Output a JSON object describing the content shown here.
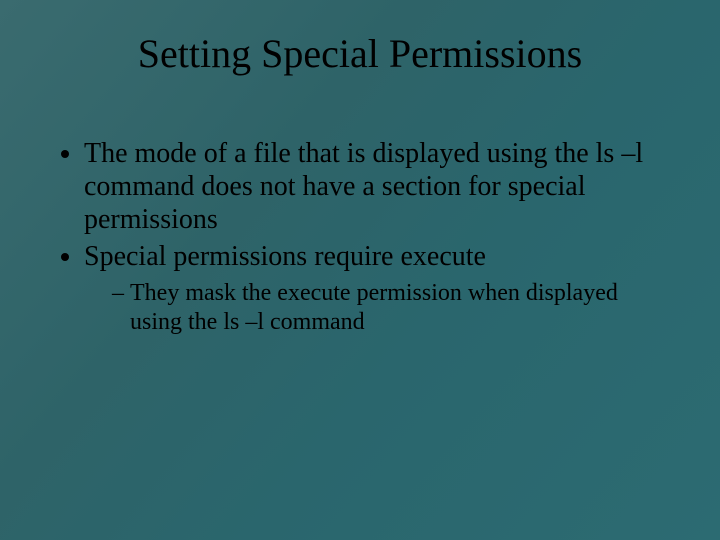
{
  "title": "Setting Special Permissions",
  "bullets": {
    "b1": "The mode of a file that is displayed using the ls –l command does not have a section for special permissions",
    "b2": "Special permissions require execute",
    "sub1": "They mask the execute permission when displayed using the ls –l command"
  }
}
